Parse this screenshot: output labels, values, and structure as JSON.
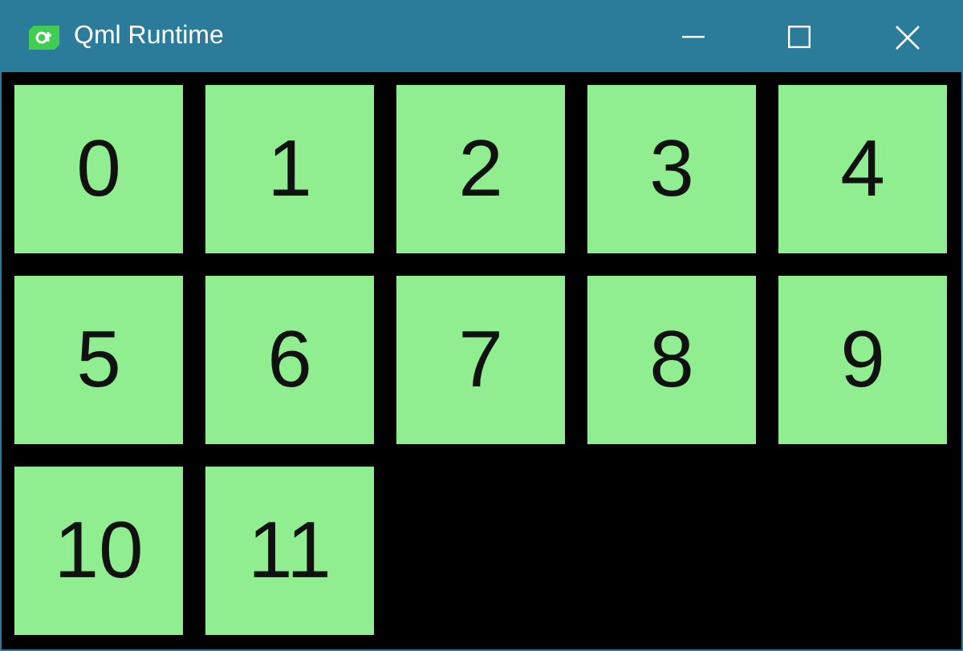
{
  "window": {
    "title": "Qml Runtime"
  },
  "tiles": [
    "0",
    "1",
    "2",
    "3",
    "4",
    "5",
    "6",
    "7",
    "8",
    "9",
    "10",
    "11"
  ]
}
